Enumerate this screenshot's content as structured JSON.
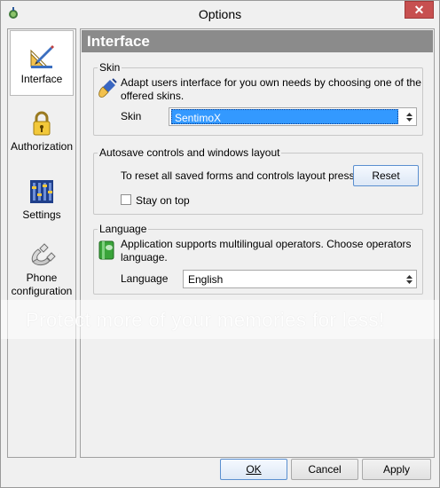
{
  "window": {
    "title": "Options",
    "close_label": "✕"
  },
  "nav": {
    "items": [
      {
        "label": "Interface",
        "icon": "ruler-pen-icon"
      },
      {
        "label": "Authorization",
        "icon": "lock-icon"
      },
      {
        "label": "Settings",
        "icon": "settings-bars-icon"
      },
      {
        "label": "Phone configuration",
        "icon": "phone-icon"
      }
    ]
  },
  "panel": {
    "title": "Interface",
    "skin": {
      "group_title": "Skin",
      "description": "Adapt users interface for you own needs by choosing one of the offered skins.",
      "field_label": "Skin",
      "selected": "SentimoX"
    },
    "autosave": {
      "group_title": "Autosave controls and windows layout",
      "reset_text": "To reset all saved forms and controls layout press",
      "reset_button": "Reset",
      "stay_on_top_label": "Stay on top",
      "stay_on_top_checked": false
    },
    "language": {
      "group_title": "Language",
      "description": "Application supports multilingual operators. Choose operators language.",
      "field_label": "Language",
      "selected": "English"
    }
  },
  "footer": {
    "ok": "OK",
    "cancel": "Cancel",
    "apply": "Apply"
  },
  "watermark": "Protect more of your memories for less!"
}
